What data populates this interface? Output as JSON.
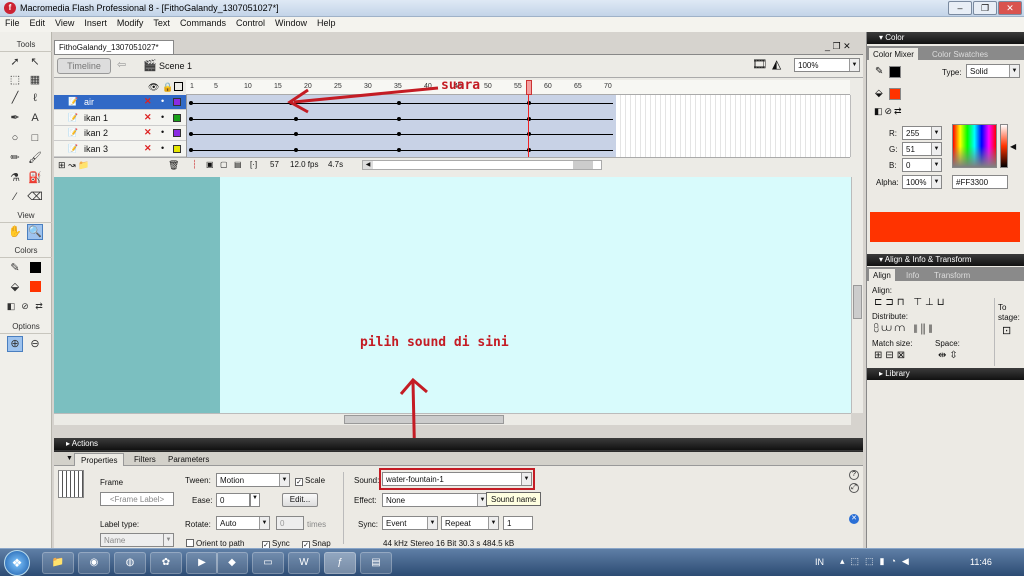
{
  "window": {
    "title": "Macromedia Flash Professional 8 - [FithoGalandy_1307051027*]",
    "app_icon": "flash-icon"
  },
  "menu": [
    "File",
    "Edit",
    "View",
    "Insert",
    "Modify",
    "Text",
    "Commands",
    "Control",
    "Window",
    "Help"
  ],
  "tools": {
    "title": "Tools",
    "view": "View",
    "colors": "Colors",
    "options": "Options"
  },
  "document": {
    "tab": "FithoGalandy_1307051027*",
    "timeline_button": "Timeline",
    "scene": "Scene 1",
    "zoom": "100%"
  },
  "timeline": {
    "ruler": [
      "1",
      "5",
      "10",
      "15",
      "20",
      "25",
      "30",
      "35",
      "40",
      "45",
      "50",
      "55",
      "60",
      "65",
      "70"
    ],
    "layers": [
      {
        "name": "air",
        "selected": true,
        "color": "#8a2be2"
      },
      {
        "name": "ikan 1",
        "selected": false,
        "color": "#19a019"
      },
      {
        "name": "ikan 2",
        "selected": false,
        "color": "#8a2be2"
      },
      {
        "name": "ikan 3",
        "selected": false,
        "color": "#e6e600"
      }
    ],
    "current_frame": "57",
    "fps": "12.0 fps",
    "time": "4.7s"
  },
  "annotations": {
    "suara": "suara",
    "pilih": "pilih sound di sini",
    "color": "#c41c24"
  },
  "panels": {
    "actions": "Actions"
  },
  "properties": {
    "tabs": [
      "Properties",
      "Filters",
      "Parameters"
    ],
    "frame_label": "Frame",
    "frame_label_placeholder": "<Frame Label>",
    "label_type_label": "Label type:",
    "label_type_value": "Name",
    "tween_label": "Tween:",
    "tween_value": "Motion",
    "scale_label": "Scale",
    "ease_label": "Ease:",
    "ease_value": "0",
    "edit_button": "Edit...",
    "rotate_label": "Rotate:",
    "rotate_value": "Auto",
    "rotate_times_value": "0",
    "times_label": "times",
    "orient_label": "Orient to path",
    "sync_check_label": "Sync",
    "snap_label": "Snap",
    "sound_label": "Sound:",
    "sound_value": "water-fountain-1",
    "sound_tooltip": "Sound name",
    "effect_label": "Effect:",
    "effect_value": "None",
    "sync_label": "Sync:",
    "sync_value": "Event",
    "repeat_value": "Repeat",
    "repeat_count": "1",
    "sound_info": "44 kHz Stereo 16 Bit 30.3 s 484.5 kB"
  },
  "color_panel": {
    "title": "Color",
    "tabs": [
      "Color Mixer",
      "Color Swatches"
    ],
    "type_label": "Type:",
    "type_value": "Solid",
    "r_label": "R:",
    "r_value": "255",
    "g_label": "G:",
    "g_value": "51",
    "b_label": "B:",
    "b_value": "0",
    "alpha_label": "Alpha:",
    "alpha_value": "100%",
    "hex_value": "#FF3300",
    "swatch": "#FF3300"
  },
  "align_panel": {
    "title": "Align & Info & Transform",
    "tabs": [
      "Align",
      "Info",
      "Transform"
    ],
    "align": "Align:",
    "distribute": "Distribute:",
    "match_size": "Match size:",
    "space": "Space:",
    "to_stage_1": "To",
    "to_stage_2": "stage:"
  },
  "library": {
    "title": "Library"
  },
  "taskbar": {
    "lang": "IN",
    "clock": "11:46"
  }
}
